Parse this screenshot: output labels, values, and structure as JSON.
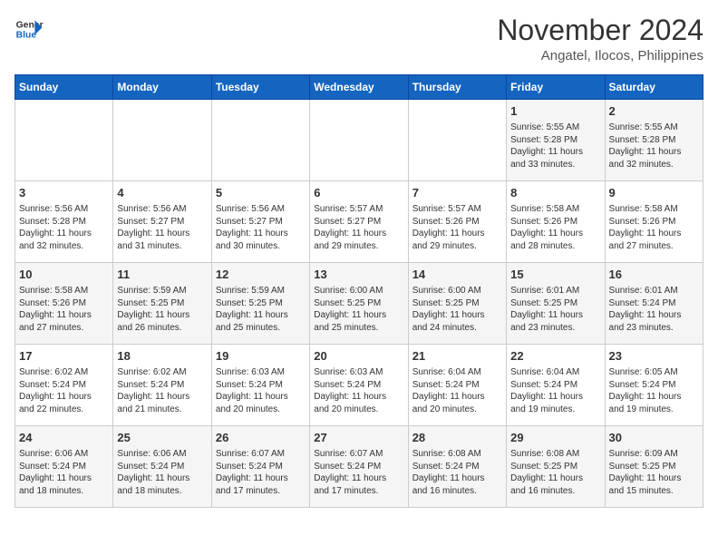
{
  "header": {
    "logo_line1": "General",
    "logo_line2": "Blue",
    "month_year": "November 2024",
    "location": "Angatel, Ilocos, Philippines"
  },
  "weekdays": [
    "Sunday",
    "Monday",
    "Tuesday",
    "Wednesday",
    "Thursday",
    "Friday",
    "Saturday"
  ],
  "weeks": [
    [
      {
        "day": "",
        "detail": ""
      },
      {
        "day": "",
        "detail": ""
      },
      {
        "day": "",
        "detail": ""
      },
      {
        "day": "",
        "detail": ""
      },
      {
        "day": "",
        "detail": ""
      },
      {
        "day": "1",
        "detail": "Sunrise: 5:55 AM\nSunset: 5:28 PM\nDaylight: 11 hours\nand 33 minutes."
      },
      {
        "day": "2",
        "detail": "Sunrise: 5:55 AM\nSunset: 5:28 PM\nDaylight: 11 hours\nand 32 minutes."
      }
    ],
    [
      {
        "day": "3",
        "detail": "Sunrise: 5:56 AM\nSunset: 5:28 PM\nDaylight: 11 hours\nand 32 minutes."
      },
      {
        "day": "4",
        "detail": "Sunrise: 5:56 AM\nSunset: 5:27 PM\nDaylight: 11 hours\nand 31 minutes."
      },
      {
        "day": "5",
        "detail": "Sunrise: 5:56 AM\nSunset: 5:27 PM\nDaylight: 11 hours\nand 30 minutes."
      },
      {
        "day": "6",
        "detail": "Sunrise: 5:57 AM\nSunset: 5:27 PM\nDaylight: 11 hours\nand 29 minutes."
      },
      {
        "day": "7",
        "detail": "Sunrise: 5:57 AM\nSunset: 5:26 PM\nDaylight: 11 hours\nand 29 minutes."
      },
      {
        "day": "8",
        "detail": "Sunrise: 5:58 AM\nSunset: 5:26 PM\nDaylight: 11 hours\nand 28 minutes."
      },
      {
        "day": "9",
        "detail": "Sunrise: 5:58 AM\nSunset: 5:26 PM\nDaylight: 11 hours\nand 27 minutes."
      }
    ],
    [
      {
        "day": "10",
        "detail": "Sunrise: 5:58 AM\nSunset: 5:26 PM\nDaylight: 11 hours\nand 27 minutes."
      },
      {
        "day": "11",
        "detail": "Sunrise: 5:59 AM\nSunset: 5:25 PM\nDaylight: 11 hours\nand 26 minutes."
      },
      {
        "day": "12",
        "detail": "Sunrise: 5:59 AM\nSunset: 5:25 PM\nDaylight: 11 hours\nand 25 minutes."
      },
      {
        "day": "13",
        "detail": "Sunrise: 6:00 AM\nSunset: 5:25 PM\nDaylight: 11 hours\nand 25 minutes."
      },
      {
        "day": "14",
        "detail": "Sunrise: 6:00 AM\nSunset: 5:25 PM\nDaylight: 11 hours\nand 24 minutes."
      },
      {
        "day": "15",
        "detail": "Sunrise: 6:01 AM\nSunset: 5:25 PM\nDaylight: 11 hours\nand 23 minutes."
      },
      {
        "day": "16",
        "detail": "Sunrise: 6:01 AM\nSunset: 5:24 PM\nDaylight: 11 hours\nand 23 minutes."
      }
    ],
    [
      {
        "day": "17",
        "detail": "Sunrise: 6:02 AM\nSunset: 5:24 PM\nDaylight: 11 hours\nand 22 minutes."
      },
      {
        "day": "18",
        "detail": "Sunrise: 6:02 AM\nSunset: 5:24 PM\nDaylight: 11 hours\nand 21 minutes."
      },
      {
        "day": "19",
        "detail": "Sunrise: 6:03 AM\nSunset: 5:24 PM\nDaylight: 11 hours\nand 20 minutes."
      },
      {
        "day": "20",
        "detail": "Sunrise: 6:03 AM\nSunset: 5:24 PM\nDaylight: 11 hours\nand 20 minutes."
      },
      {
        "day": "21",
        "detail": "Sunrise: 6:04 AM\nSunset: 5:24 PM\nDaylight: 11 hours\nand 20 minutes."
      },
      {
        "day": "22",
        "detail": "Sunrise: 6:04 AM\nSunset: 5:24 PM\nDaylight: 11 hours\nand 19 minutes."
      },
      {
        "day": "23",
        "detail": "Sunrise: 6:05 AM\nSunset: 5:24 PM\nDaylight: 11 hours\nand 19 minutes."
      }
    ],
    [
      {
        "day": "24",
        "detail": "Sunrise: 6:06 AM\nSunset: 5:24 PM\nDaylight: 11 hours\nand 18 minutes."
      },
      {
        "day": "25",
        "detail": "Sunrise: 6:06 AM\nSunset: 5:24 PM\nDaylight: 11 hours\nand 18 minutes."
      },
      {
        "day": "26",
        "detail": "Sunrise: 6:07 AM\nSunset: 5:24 PM\nDaylight: 11 hours\nand 17 minutes."
      },
      {
        "day": "27",
        "detail": "Sunrise: 6:07 AM\nSunset: 5:24 PM\nDaylight: 11 hours\nand 17 minutes."
      },
      {
        "day": "28",
        "detail": "Sunrise: 6:08 AM\nSunset: 5:24 PM\nDaylight: 11 hours\nand 16 minutes."
      },
      {
        "day": "29",
        "detail": "Sunrise: 6:08 AM\nSunset: 5:25 PM\nDaylight: 11 hours\nand 16 minutes."
      },
      {
        "day": "30",
        "detail": "Sunrise: 6:09 AM\nSunset: 5:25 PM\nDaylight: 11 hours\nand 15 minutes."
      }
    ]
  ]
}
